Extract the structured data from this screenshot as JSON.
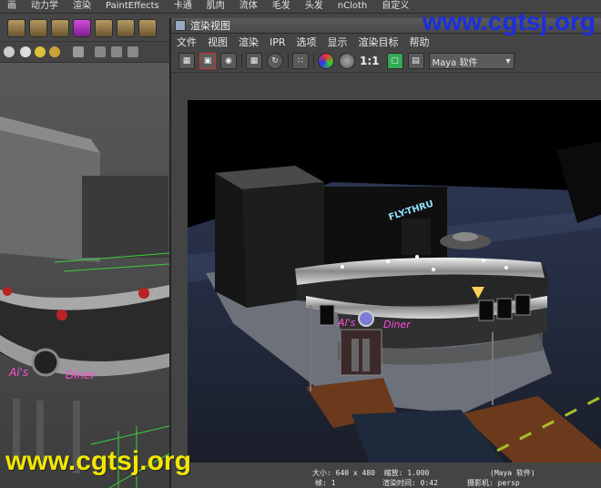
{
  "main_menu": [
    "画",
    "动力学",
    "渲染",
    "PaintEffects",
    "卡通",
    "肌肉",
    "流体",
    "毛发",
    "头发",
    "nCloth",
    "自定义"
  ],
  "render_window": {
    "title": "渲染视图",
    "menu": [
      "文件",
      "视图",
      "渲染",
      "IPR",
      "选项",
      "显示",
      "渲染目标",
      "帮助"
    ],
    "ratio_label": "1:1",
    "renderer": "Maya 软件",
    "status": {
      "size": "大小: 640 x 480  缩放: 1.000",
      "renderer": "(Maya 软件)",
      "frame": "帧: 1",
      "render_time": "渲染时间: 0:42",
      "camera": "摄影机: persp"
    }
  },
  "scene_sign": "FLY-THRU",
  "watermark": "www.cgtsj.org",
  "colors": {
    "watermark_top": "#1b2ee0",
    "watermark_bottom": "#f2e600",
    "neon_pink": "#ff4fd8"
  }
}
